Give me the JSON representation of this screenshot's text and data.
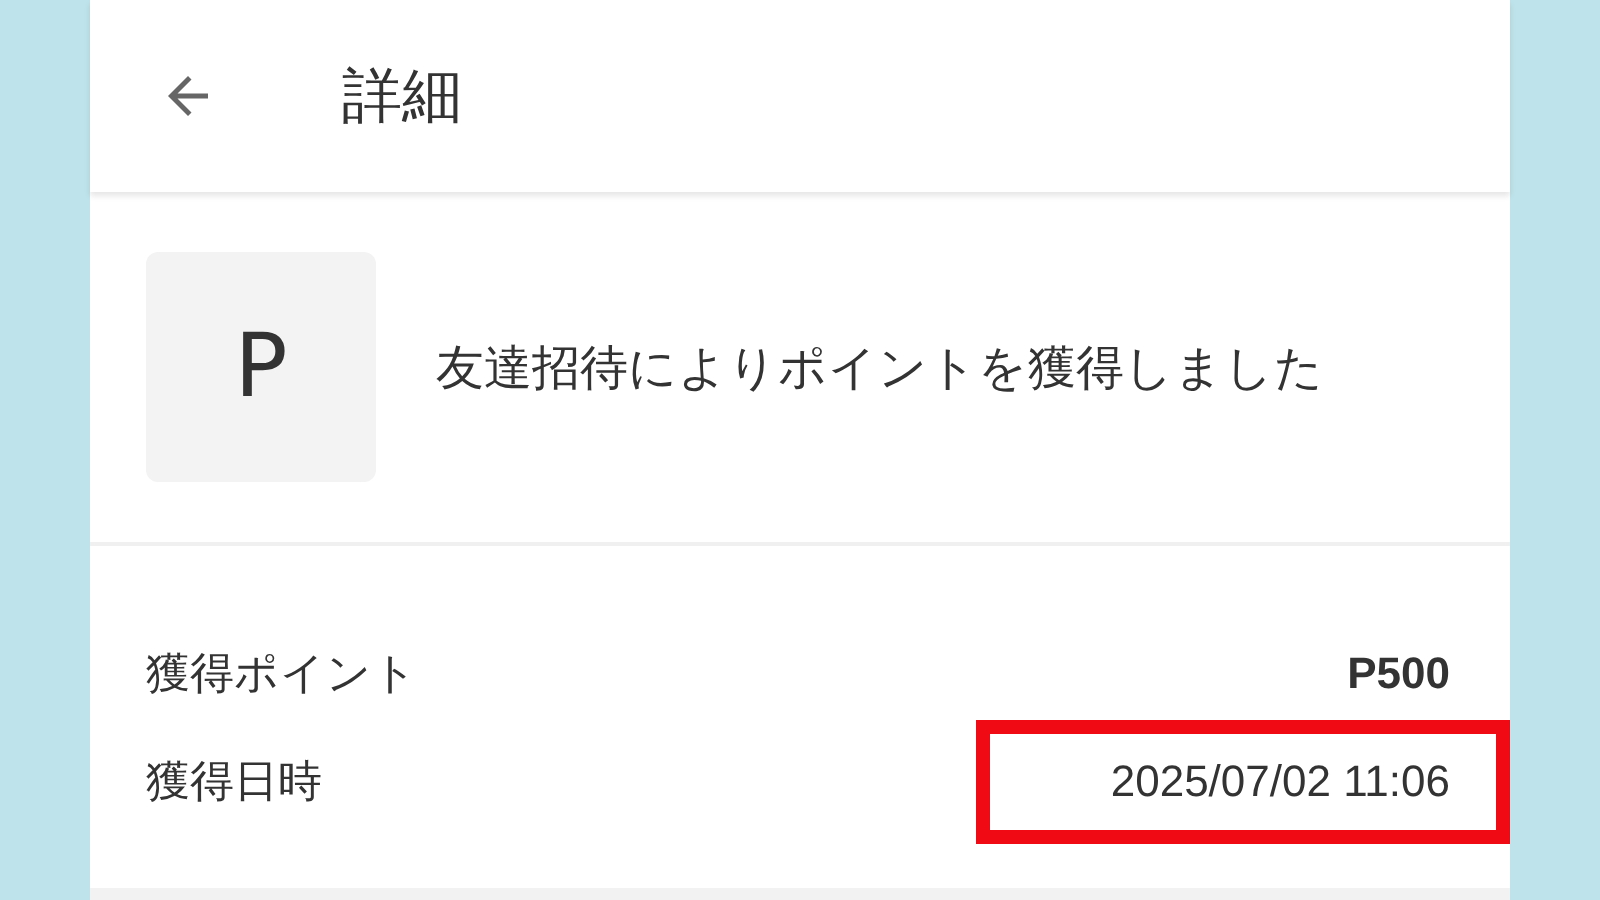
{
  "header": {
    "title": "詳細"
  },
  "summary": {
    "icon_letter": "P",
    "message": "友達招待によりポイントを獲得しました"
  },
  "details": [
    {
      "label": "獲得ポイント",
      "value": "P500",
      "bold": true,
      "highlighted": false
    },
    {
      "label": "獲得日時",
      "value": "2025/07/02 11:06",
      "bold": false,
      "highlighted": true
    }
  ]
}
